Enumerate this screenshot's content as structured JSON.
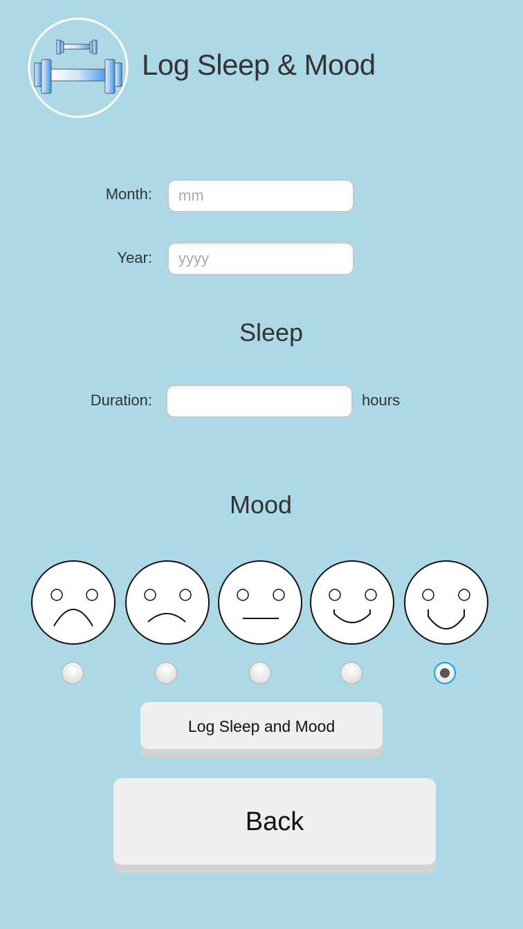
{
  "header": {
    "title": "Log Sleep & Mood",
    "logo_icon": "dumbbell-icon"
  },
  "form": {
    "month": {
      "label": "Month:",
      "value": "",
      "placeholder": "mm"
    },
    "year": {
      "label": "Year:",
      "value": "",
      "placeholder": "yyyy"
    }
  },
  "sleep": {
    "heading": "Sleep",
    "duration": {
      "label": "Duration:",
      "value": "",
      "placeholder": "",
      "unit": "hours"
    }
  },
  "mood": {
    "heading": "Mood",
    "options": [
      {
        "icon": "very-sad-face-icon",
        "selected": false
      },
      {
        "icon": "sad-face-icon",
        "selected": false
      },
      {
        "icon": "neutral-face-icon",
        "selected": false
      },
      {
        "icon": "happy-face-icon",
        "selected": false
      },
      {
        "icon": "very-happy-face-icon",
        "selected": true
      }
    ],
    "selected_index": 4
  },
  "actions": {
    "log_label": "Log Sleep and Mood",
    "back_label": "Back"
  },
  "colors": {
    "background": "#add8e6",
    "button": "#efefef",
    "radio_selected_ring": "#1fa0e8"
  }
}
